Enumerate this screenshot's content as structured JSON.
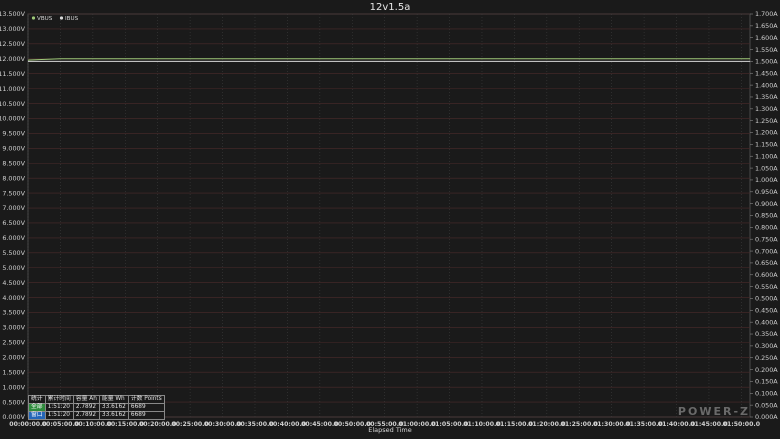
{
  "chart_data": {
    "type": "line",
    "title": "12v1.5a",
    "xlabel": "Elapsed Time",
    "x_ticks": [
      "00:00:00.0",
      "00:05:00.0",
      "00:10:00.0",
      "00:15:00.0",
      "00:20:00.0",
      "00:25:00.0",
      "00:30:00.0",
      "00:35:00.0",
      "00:40:00.0",
      "00:45:00.0",
      "00:50:00.0",
      "00:55:00.0",
      "01:00:00.0",
      "01:05:00.0",
      "01:10:00.0",
      "01:15:00.0",
      "01:20:00.0",
      "01:25:00.0",
      "01:30:00.0",
      "01:35:00.0",
      "01:40:00.0",
      "01:45:00.0",
      "01:50:00.0"
    ],
    "x_range_min": [
      0,
      111.33
    ],
    "y_left": {
      "unit": "V",
      "ylim": [
        0,
        13.5
      ],
      "ticks": [
        "0.000V",
        "0.500V",
        "1.000V",
        "1.500V",
        "2.000V",
        "2.500V",
        "3.000V",
        "3.500V",
        "4.000V",
        "4.500V",
        "5.000V",
        "5.500V",
        "6.000V",
        "6.500V",
        "7.000V",
        "7.500V",
        "8.000V",
        "8.500V",
        "9.000V",
        "9.500V",
        "10.000V",
        "10.500V",
        "11.000V",
        "11.500V",
        "12.000V",
        "12.500V",
        "13.000V",
        "13.500V"
      ]
    },
    "y_right": {
      "unit": "A",
      "ylim": [
        0,
        1.7
      ],
      "ticks": [
        "0.000A",
        "0.050A",
        "0.100A",
        "0.150A",
        "0.200A",
        "0.250A",
        "0.300A",
        "0.350A",
        "0.400A",
        "0.450A",
        "0.500A",
        "0.550A",
        "0.600A",
        "0.650A",
        "0.700A",
        "0.750A",
        "0.800A",
        "0.850A",
        "0.900A",
        "0.950A",
        "1.000A",
        "1.050A",
        "1.100A",
        "1.150A",
        "1.200A",
        "1.250A",
        "1.300A",
        "1.350A",
        "1.400A",
        "1.450A",
        "1.500A",
        "1.550A",
        "1.600A",
        "1.650A",
        "1.700A"
      ]
    },
    "grid": true,
    "legend_position": "top-left",
    "series": [
      {
        "name": "VBUS",
        "axis": "left",
        "color": "#9ec878",
        "x": [
          0,
          0.2,
          5,
          111.33
        ],
        "y": [
          11.95,
          11.96,
          12.0,
          12.0
        ]
      },
      {
        "name": "IBUS",
        "axis": "right",
        "color": "#d8d8d8",
        "x": [
          0,
          111.33
        ],
        "y": [
          1.5,
          1.5
        ]
      }
    ]
  },
  "stats": {
    "headers": [
      "统计",
      "累计时间",
      "容量 Ah",
      "能量 Wh",
      "计数 Points"
    ],
    "rows": [
      {
        "label": "全部",
        "time": "1:51:20",
        "ah": "2.7892",
        "wh": "33.6162",
        "points": "6689"
      },
      {
        "label": "窗口",
        "time": "1:51:20",
        "ah": "2.7892",
        "wh": "33.6162",
        "points": "6689"
      }
    ]
  },
  "logo": "POWER-Z"
}
